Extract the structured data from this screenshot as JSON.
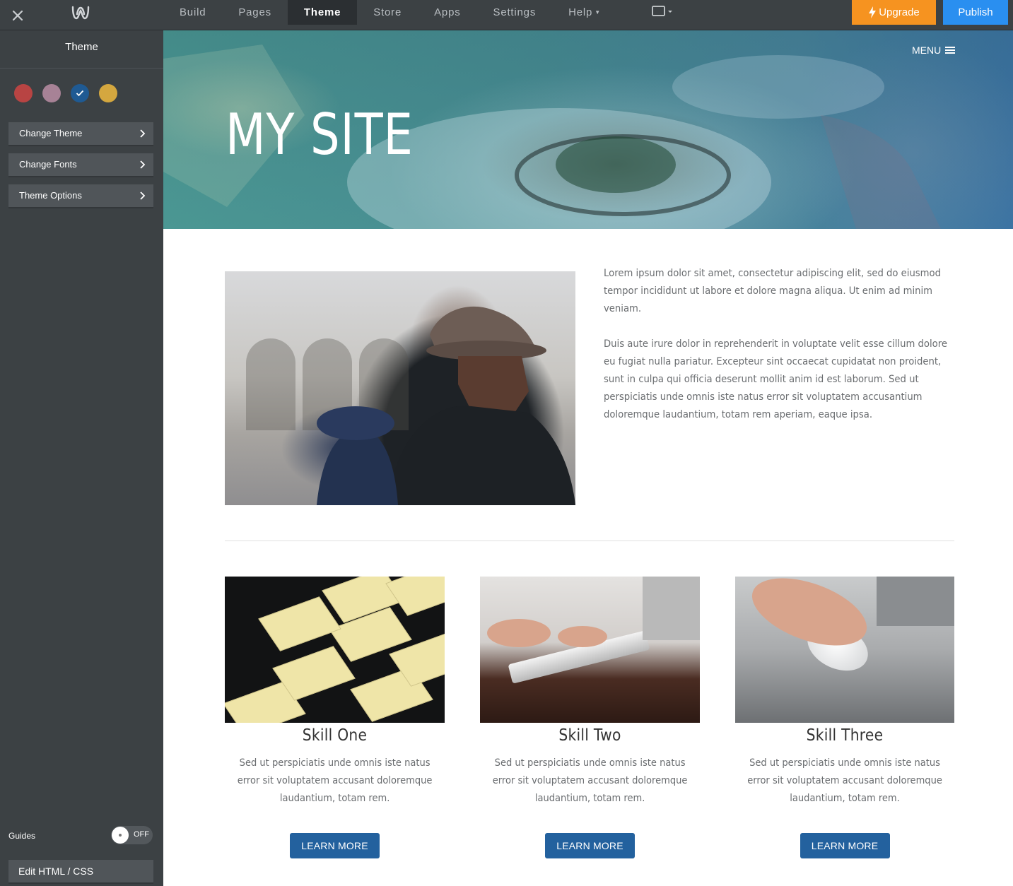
{
  "topbar": {
    "nav": [
      {
        "label": "Build",
        "active": false,
        "has_caret": false
      },
      {
        "label": "Pages",
        "active": false,
        "has_caret": false
      },
      {
        "label": "Theme",
        "active": true,
        "has_caret": false
      },
      {
        "label": "Store",
        "active": false,
        "has_caret": false
      },
      {
        "label": "Apps",
        "active": false,
        "has_caret": false
      },
      {
        "label": "Settings",
        "active": false,
        "has_caret": false
      },
      {
        "label": "Help",
        "active": false,
        "has_caret": true
      }
    ],
    "upgrade_label": "Upgrade",
    "publish_label": "Publish",
    "icons": {
      "close": "close-icon",
      "logo": "weebly-logo-icon",
      "device": "device-preview-icon",
      "upgrade": "lightning-icon"
    },
    "colors": {
      "upgrade": "#f69320",
      "publish": "#2a8ff0",
      "bar": "#3c4144"
    }
  },
  "sidebar": {
    "title": "Theme",
    "swatches": [
      {
        "color": "#b84443",
        "selected": false
      },
      {
        "color": "#a78296",
        "selected": false
      },
      {
        "color": "#1f5a93",
        "selected": true
      },
      {
        "color": "#d4a73f",
        "selected": false
      }
    ],
    "items": [
      {
        "label": "Change Theme"
      },
      {
        "label": "Change Fonts"
      },
      {
        "label": "Theme Options"
      }
    ],
    "guides_label": "Guides",
    "guides_state": "OFF",
    "edit_html_label": "Edit HTML / CSS"
  },
  "site": {
    "hero_title": "MY SITE",
    "menu_label": "MENU",
    "intro_paragraphs": [
      "Lorem ipsum dolor sit amet, consectetur adipiscing elit, sed do eiusmod tempor incididunt ut labore et dolore magna aliqua. Ut enim ad minim veniam.",
      "Duis aute irure dolor in reprehenderit in voluptate velit esse cillum dolore eu fugiat nulla pariatur. Excepteur sint occaecat cupidatat non proident, sunt in culpa qui officia deserunt mollit anim id est laborum. Sed ut perspiciatis unde omnis iste natus error sit voluptatem accusantium doloremque laudantium, totam rem aperiam, eaque ipsa."
    ],
    "skills": [
      {
        "title": "Skill One",
        "description": "Sed ut perspiciatis unde omnis iste natus error sit voluptatem accusant doloremque laudantium, totam rem.",
        "button": "LEARN MORE"
      },
      {
        "title": "Skill Two",
        "description": "Sed ut perspiciatis unde omnis iste natus error sit voluptatem accusant doloremque laudantium, totam rem.",
        "button": "LEARN MORE"
      },
      {
        "title": "Skill Three",
        "description": "Sed ut perspiciatis unde omnis iste natus error sit voluptatem accusant doloremque laudantium, totam rem.",
        "button": "LEARN MORE"
      }
    ],
    "accent_color": "#23619e"
  }
}
